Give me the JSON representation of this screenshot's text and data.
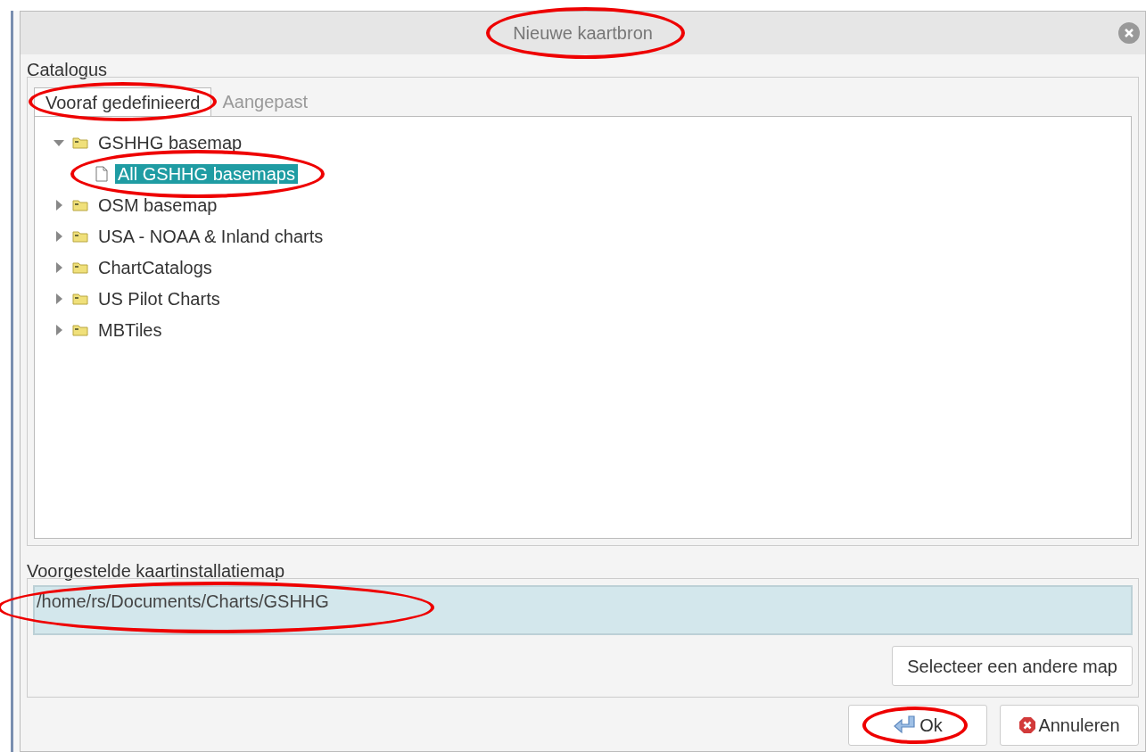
{
  "window": {
    "title": "Nieuwe kaartbron",
    "title_circled": true
  },
  "catalog": {
    "label": "Catalogus",
    "tabs": [
      {
        "label": "Vooraf gedefinieerd",
        "selected": true,
        "circled": true
      },
      {
        "label": "Aangepast",
        "selected": false,
        "circled": false
      }
    ],
    "tree": [
      {
        "kind": "folder",
        "label": "GSHHG basemap",
        "expanded": true,
        "selected": false,
        "circled": false,
        "children": [
          {
            "kind": "file",
            "label": "All GSHHG basemaps",
            "selected": true,
            "circled": true
          }
        ]
      },
      {
        "kind": "folder",
        "label": "OSM basemap",
        "expanded": false,
        "selected": false,
        "circled": false
      },
      {
        "kind": "folder",
        "label": "USA - NOAA & Inland charts",
        "expanded": false,
        "selected": false,
        "circled": false
      },
      {
        "kind": "folder",
        "label": "ChartCatalogs",
        "expanded": false,
        "selected": false,
        "circled": false
      },
      {
        "kind": "folder",
        "label": "US Pilot Charts",
        "expanded": false,
        "selected": false,
        "circled": false
      },
      {
        "kind": "folder",
        "label": "MBTiles",
        "expanded": false,
        "selected": false,
        "circled": false
      }
    ]
  },
  "install_dir": {
    "label": "Voorgestelde kaartinstallatiemap",
    "value": "/home/rs/Documents/Charts/GSHHG",
    "circled": true,
    "browse_button": "Selecteer een andere map"
  },
  "buttons": [
    {
      "kind": "ok",
      "label": "Ok",
      "circled": true
    },
    {
      "kind": "cancel",
      "label": "Annuleren",
      "circled": false
    }
  ]
}
